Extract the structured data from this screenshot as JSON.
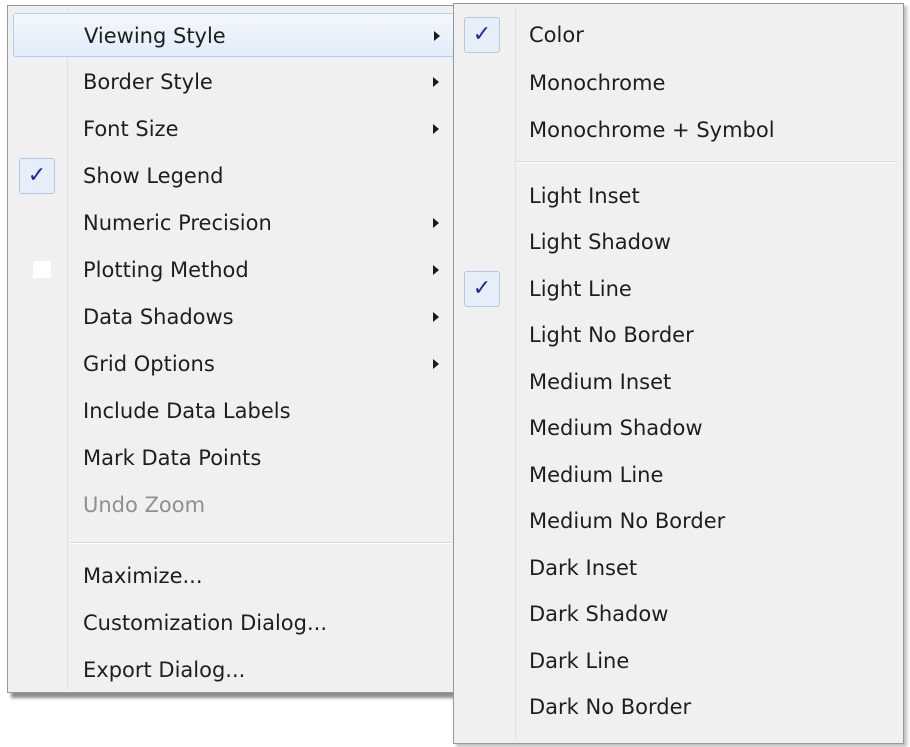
{
  "main_menu": {
    "items": [
      {
        "label": "Viewing Style"
      },
      {
        "label": "Border Style"
      },
      {
        "label": "Font Size"
      },
      {
        "label": "Show Legend",
        "checked": true
      },
      {
        "label": "Numeric Precision"
      },
      {
        "label": "Plotting Method",
        "checked": false
      },
      {
        "label": "Data Shadows"
      },
      {
        "label": "Grid Options"
      },
      {
        "label": "Include Data Labels"
      },
      {
        "label": "Mark Data Points"
      },
      {
        "label": "Undo Zoom",
        "enabled": false
      },
      {
        "label": "Maximize..."
      },
      {
        "label": "Customization Dialog..."
      },
      {
        "label": "Export Dialog..."
      }
    ]
  },
  "sub_menu": {
    "items": [
      {
        "label": "Color",
        "checked": true
      },
      {
        "label": "Monochrome"
      },
      {
        "label": "Monochrome + Symbol"
      },
      {
        "label": "Light Inset"
      },
      {
        "label": "Light Shadow"
      },
      {
        "label": "Light Line",
        "checked": true
      },
      {
        "label": "Light No Border"
      },
      {
        "label": "Medium Inset"
      },
      {
        "label": "Medium Shadow"
      },
      {
        "label": "Medium Line"
      },
      {
        "label": "Medium No Border"
      },
      {
        "label": "Dark Inset"
      },
      {
        "label": "Dark Shadow"
      },
      {
        "label": "Dark Line"
      },
      {
        "label": "Dark No Border"
      }
    ]
  },
  "check_glyph": "✓",
  "colors": {
    "menu_background": "#f0f0f0",
    "highlight": "#e1ecfa",
    "check": "#1a2a9c",
    "disabled_text": "#8f8f8f"
  }
}
